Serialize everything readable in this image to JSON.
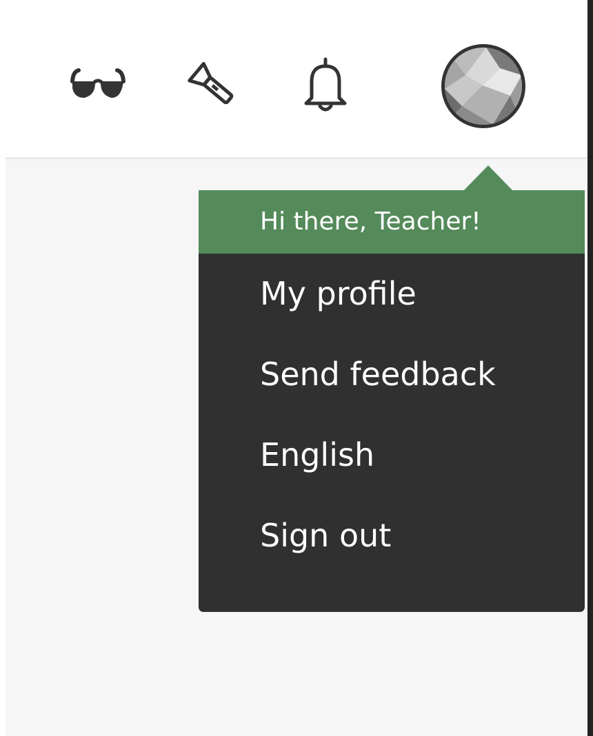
{
  "header": {
    "icons": {
      "glasses": "glasses-icon",
      "flashlight": "flashlight-icon",
      "notifications": "bell-icon",
      "avatar": "avatar"
    }
  },
  "user_menu": {
    "greeting": "Hi there, Teacher!",
    "items": [
      {
        "label": "My profile"
      },
      {
        "label": "Send feedback"
      },
      {
        "label": "English"
      },
      {
        "label": "Sign out"
      }
    ]
  },
  "colors": {
    "accent": "#558a5a",
    "menu_background": "#303030",
    "content_background": "#f6f6f6",
    "icon": "#333333"
  }
}
